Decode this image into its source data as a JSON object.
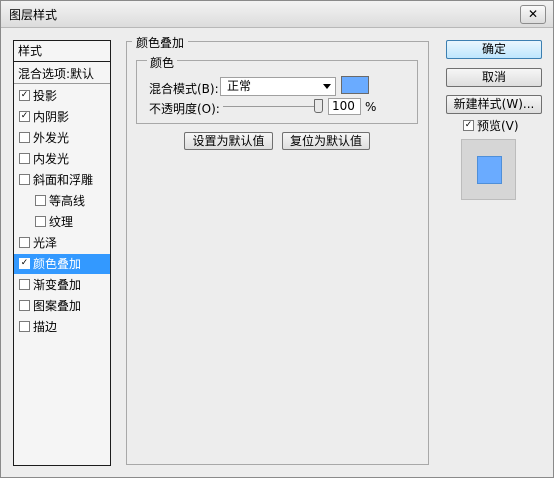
{
  "window": {
    "title": "图层样式",
    "close_label": "✕"
  },
  "list": {
    "header": "样式",
    "blend_options": "混合选项:默认",
    "items": [
      {
        "label": "投影",
        "checked": true,
        "sub": false,
        "selected": false
      },
      {
        "label": "内阴影",
        "checked": true,
        "sub": false,
        "selected": false
      },
      {
        "label": "外发光",
        "checked": false,
        "sub": false,
        "selected": false
      },
      {
        "label": "内发光",
        "checked": false,
        "sub": false,
        "selected": false
      },
      {
        "label": "斜面和浮雕",
        "checked": false,
        "sub": false,
        "selected": false
      },
      {
        "label": "等高线",
        "checked": false,
        "sub": true,
        "selected": false
      },
      {
        "label": "纹理",
        "checked": false,
        "sub": true,
        "selected": false
      },
      {
        "label": "光泽",
        "checked": false,
        "sub": false,
        "selected": false
      },
      {
        "label": "颜色叠加",
        "checked": true,
        "sub": false,
        "selected": true
      },
      {
        "label": "渐变叠加",
        "checked": false,
        "sub": false,
        "selected": false
      },
      {
        "label": "图案叠加",
        "checked": false,
        "sub": false,
        "selected": false
      },
      {
        "label": "描边",
        "checked": false,
        "sub": false,
        "selected": false
      }
    ]
  },
  "panel": {
    "title": "颜色叠加",
    "subtitle": "颜色",
    "blend_mode_label": "混合模式(B):",
    "blend_mode_value": "正常",
    "overlay_color": "#6aabff",
    "opacity_label": "不透明度(O):",
    "opacity_value": "100",
    "opacity_unit": "%",
    "opacity_level": 1.0,
    "set_default_label": "设置为默认值",
    "reset_default_label": "复位为默认值"
  },
  "buttons": {
    "ok": "确定",
    "cancel": "取消",
    "new_style": "新建样式(W)..."
  },
  "preview": {
    "label": "预览(V)",
    "checked": true,
    "swatch_color": "#6aabff"
  },
  "check_mark": "✓"
}
